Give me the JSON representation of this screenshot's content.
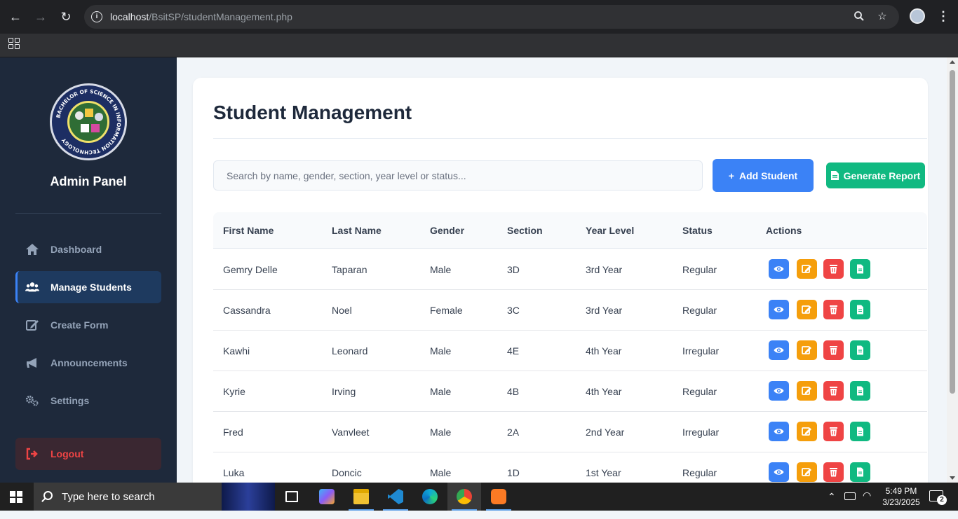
{
  "browser": {
    "url_host": "localhost",
    "url_path": "/BsitSP/studentManagement.php"
  },
  "sidebar": {
    "logo_text": "BACHELOR OF SCIENCE IN INFORMATION TECHNOLOGY",
    "title": "Admin Panel",
    "items": [
      {
        "label": "Dashboard",
        "icon": "home-icon"
      },
      {
        "label": "Manage Students",
        "icon": "users-icon"
      },
      {
        "label": "Create Form",
        "icon": "edit-icon"
      },
      {
        "label": "Announcements",
        "icon": "megaphone-icon"
      },
      {
        "label": "Settings",
        "icon": "cogs-icon"
      }
    ],
    "logout_label": "Logout"
  },
  "main": {
    "title": "Student Management",
    "search_placeholder": "Search by name, gender, section, year level or status...",
    "add_label": "Add Student",
    "report_label": "Generate Report",
    "columns": [
      "First Name",
      "Last Name",
      "Gender",
      "Section",
      "Year Level",
      "Status",
      "Actions"
    ],
    "rows": [
      {
        "first": "Gemry Delle",
        "last": "Taparan",
        "gender": "Male",
        "section": "3D",
        "year": "3rd Year",
        "status": "Regular"
      },
      {
        "first": "Cassandra",
        "last": "Noel",
        "gender": "Female",
        "section": "3C",
        "year": "3rd Year",
        "status": "Regular"
      },
      {
        "first": "Kawhi",
        "last": "Leonard",
        "gender": "Male",
        "section": "4E",
        "year": "4th Year",
        "status": "Irregular"
      },
      {
        "first": "Kyrie",
        "last": "Irving",
        "gender": "Male",
        "section": "4B",
        "year": "4th Year",
        "status": "Regular"
      },
      {
        "first": "Fred",
        "last": "Vanvleet",
        "gender": "Male",
        "section": "2A",
        "year": "2nd Year",
        "status": "Irregular"
      },
      {
        "first": "Luka",
        "last": "Doncic",
        "gender": "Male",
        "section": "1D",
        "year": "1st Year",
        "status": "Regular"
      }
    ]
  },
  "taskbar": {
    "search_text": "Type here to search",
    "time": "5:49 PM",
    "date": "3/23/2025",
    "notification_count": "2"
  },
  "colors": {
    "sidebar_bg": "#1e293b",
    "primary": "#3b82f6",
    "success": "#10b981",
    "warning": "#f59e0b",
    "danger": "#ef4444"
  }
}
